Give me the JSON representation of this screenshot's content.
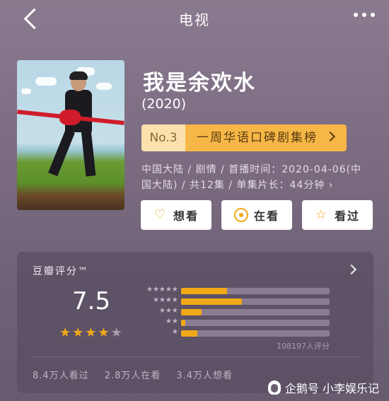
{
  "header": {
    "title": "电视"
  },
  "show": {
    "name": "我是余欢水",
    "year": "(2020)",
    "rank_no": "No.3",
    "rank_label": "一周华语口碑剧集榜",
    "meta": "中国大陆 / 剧情 / 首播时间：2020-04-06(中国大陆) / 共12集 / 单集片长：44分钟 ›"
  },
  "actions": [
    {
      "label": "想看",
      "icon": "heart-plus-icon"
    },
    {
      "label": "在看",
      "icon": "target-icon"
    },
    {
      "label": "看过",
      "icon": "star-outline-icon"
    }
  ],
  "rating": {
    "title": "豆瓣评分™",
    "score": "7.5",
    "stars_filled": 4,
    "stars_total": 5,
    "distribution": [
      {
        "stars": "★★★★★",
        "fraction": 0.31
      },
      {
        "stars": "★★★★",
        "fraction": 0.41
      },
      {
        "stars": "★★★",
        "fraction": 0.14
      },
      {
        "stars": "★★",
        "fraction": 0.03
      },
      {
        "stars": "★",
        "fraction": 0.11
      }
    ],
    "count_text": "108197人评分",
    "seen": [
      "8.4万人看过",
      "2.8万人在看",
      "3.4万人想看"
    ]
  },
  "watermark": {
    "text": "企鹅号 小李娱乐记"
  },
  "colors": {
    "accent": "#f2a918",
    "rank_bg": "#f6b747",
    "rank_no_bg": "#fae1ae"
  }
}
